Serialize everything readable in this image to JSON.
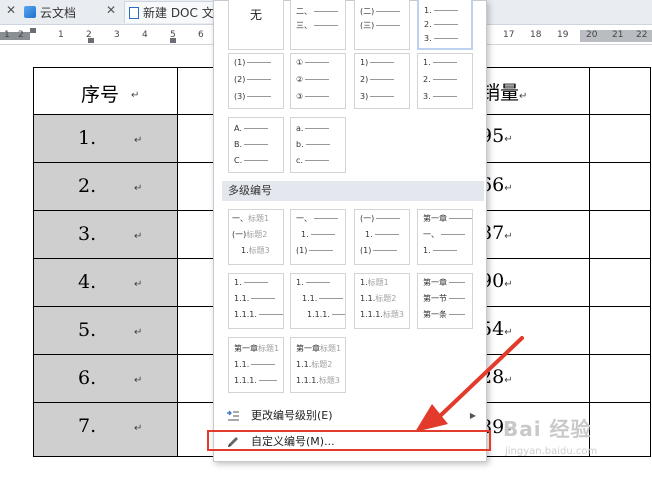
{
  "tabs": [
    {
      "label": "云文档",
      "icon": "cloud-cube-icon"
    },
    {
      "label": "新建 DOC 文",
      "icon": "document-icon"
    }
  ],
  "ruler": {
    "numbers": [
      "1",
      "2",
      "1",
      "2",
      "3",
      "4",
      "5",
      "6",
      "17",
      "18",
      "19",
      "20",
      "21",
      "22"
    ]
  },
  "table": {
    "header_left": "序号",
    "header_right": "销量",
    "rows": [
      "1.",
      "2.",
      "3.",
      "4.",
      "5.",
      "6.",
      "7."
    ],
    "sales": [
      "95",
      "66",
      "87",
      "90",
      "54",
      "28",
      "89"
    ]
  },
  "paragraph_mark": "↵",
  "numbering_panel": {
    "none_label": "无",
    "single_level": [
      {
        "lines": [
          "",
          "",
          ""
        ]
      },
      {
        "lines": [
          "二、",
          "三、",
          ""
        ]
      },
      {
        "lines": [
          "(二)",
          "(三)",
          ""
        ]
      },
      {
        "lines": [
          "1.",
          "2.",
          "3."
        ]
      },
      {
        "lines": [
          "(1)",
          "(2)",
          "(3)"
        ]
      },
      {
        "lines": [
          "①",
          "②",
          "③"
        ]
      },
      {
        "lines": [
          "1)",
          "2)",
          "3)"
        ]
      },
      {
        "lines": [
          "1.",
          "2.",
          "3."
        ]
      },
      {
        "lines": [
          "A.",
          "B.",
          "C."
        ]
      },
      {
        "lines": [
          "a.",
          "b.",
          "c."
        ]
      }
    ],
    "multilevel_header": "多级编号",
    "multi_level": [
      {
        "lines": [
          [
            "一、",
            "标题1"
          ],
          [
            "(一)",
            "标题2"
          ],
          [
            "1.",
            "标题3"
          ]
        ]
      },
      {
        "lines": [
          [
            "一、",
            ""
          ],
          [
            "1.",
            ""
          ],
          [
            "(1)",
            ""
          ]
        ]
      },
      {
        "lines": [
          [
            "(一)",
            ""
          ],
          [
            "1.",
            ""
          ],
          [
            "(1)",
            ""
          ]
        ]
      },
      {
        "lines": [
          [
            "第一章",
            ""
          ],
          [
            "一、",
            ""
          ],
          [
            "1.",
            ""
          ]
        ]
      },
      {
        "lines": [
          [
            "1.",
            ""
          ],
          [
            "1.1.",
            ""
          ],
          [
            "1.1.1.",
            ""
          ]
        ]
      },
      {
        "lines": [
          [
            "1.",
            ""
          ],
          [
            "1.1.",
            ""
          ],
          [
            "1.1.1.",
            ""
          ]
        ]
      },
      {
        "lines": [
          [
            "1.",
            "标题1"
          ],
          [
            "1.1.",
            "标题2"
          ],
          [
            "1.1.1.",
            "标题3"
          ]
        ]
      },
      {
        "lines": [
          [
            "第一章",
            ""
          ],
          [
            "第一节",
            ""
          ],
          [
            "第一条",
            ""
          ]
        ]
      },
      {
        "lines": [
          [
            "第一章",
            "标题1"
          ],
          [
            "1.1.",
            ""
          ],
          [
            "1.1.1.",
            ""
          ]
        ]
      },
      {
        "lines": [
          [
            "第一章",
            "标题1"
          ],
          [
            "1.1.",
            "标题2"
          ],
          [
            "1.1.1.",
            "标题3"
          ]
        ]
      }
    ],
    "change_level_label": "更改编号级别(E)",
    "custom_label": "自定义编号(M)..."
  },
  "watermark": {
    "text": "Bai 经验",
    "sub": "jingyan.baidu.com"
  },
  "colors": {
    "highlight_red": "#e23a2b",
    "selected_border": "#bcd2ef",
    "cell_gray": "#cfcfcf"
  }
}
